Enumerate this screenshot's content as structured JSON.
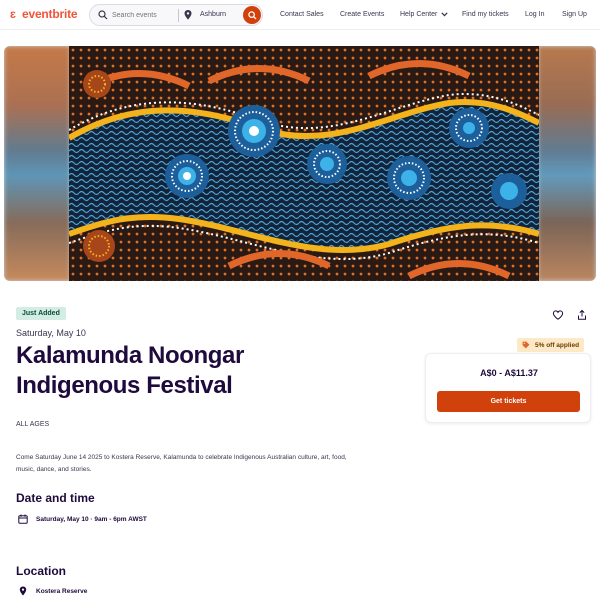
{
  "brand": {
    "logo_text": "eventbrite",
    "accent": "#d1410c",
    "logo_color": "#f05537"
  },
  "search": {
    "placeholder": "Search events",
    "location": "Ashburn"
  },
  "nav": {
    "contact_sales": "Contact Sales",
    "create_events": "Create Events",
    "help_center": "Help Center",
    "find_tickets": "Find my tickets",
    "login": "Log In",
    "signup": "Sign Up"
  },
  "event": {
    "badge": "Just Added",
    "date_short": "Saturday, May 10",
    "title": "Kalamunda Noongar Indigenous Festival",
    "ages": "ALL AGES",
    "description": "Come Saturday June 14 2025 to Kostera Reserve, Kalamunda to celebrate Indigenous Australian culture, art, food, music, dance, and stories."
  },
  "date_time": {
    "heading": "Date and time",
    "value": "Saturday, May 10 · 9am - 6pm AWST"
  },
  "location": {
    "heading": "Location",
    "venue": "Kostera Reserve"
  },
  "tickets": {
    "promo": "5% off applied",
    "price": "A$0 - A$11.37",
    "button": "Get tickets"
  },
  "icons": [
    "search-icon",
    "location-pin-icon",
    "chevron-down-icon",
    "heart-icon",
    "share-icon",
    "calendar-icon",
    "tag-icon"
  ]
}
